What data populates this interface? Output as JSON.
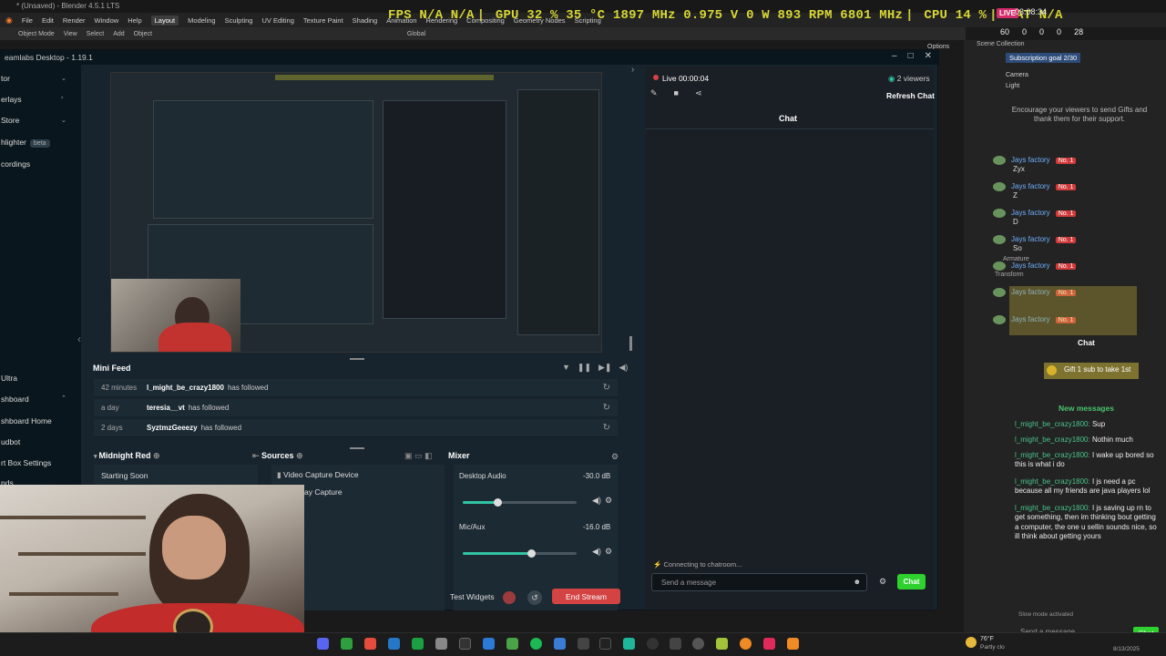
{
  "blender": {
    "title": "* (Unsaved) - Blender 4.5.1 LTS",
    "menu": [
      "File",
      "Edit",
      "Render",
      "Window",
      "Help"
    ],
    "workspaces": [
      "Layout",
      "Modeling",
      "Sculpting",
      "UV Editing",
      "Texture Paint",
      "Shading",
      "Animation",
      "Rendering",
      "Compositing",
      "Geometry Nodes",
      "Scripting"
    ],
    "active_workspace": "Layout",
    "toolbar": [
      "Object Mode",
      "View",
      "Select",
      "Add",
      "Object",
      "Global"
    ],
    "options": "Options",
    "scene_collection": "Scene Collection",
    "outliner": [
      "Camera",
      "Light"
    ],
    "properties": [
      "Armature",
      "Transform"
    ]
  },
  "perf_overlay": {
    "fps": "FPS N/A N/A",
    "gpu": "GPU 32 % 35 °C 1897 MHz 0.975 V 0 W 893 RPM 6801 MHz",
    "cpu": "CPU 14 %",
    "lat": "LAT N/A"
  },
  "stream_overlay": {
    "live": "LIVE",
    "clock": "03:08:34",
    "stats": [
      "60",
      "0",
      "0",
      "0",
      "28"
    ]
  },
  "streamlabs": {
    "title": "eamlabs Desktop - 1.19.1",
    "sidebar": [
      {
        "label": "tor",
        "chevron": true
      },
      {
        "label": "erlays",
        "chevron": false
      },
      {
        "label": "Store",
        "chevron": true
      },
      {
        "label": "hlighter",
        "beta": "beta"
      },
      {
        "label": "cordings"
      },
      {
        "label": "Ultra"
      },
      {
        "label": "shboard",
        "chevron": true
      },
      {
        "label": "shboard Home"
      },
      {
        "label": "udbot"
      },
      {
        "label": "rt Box Settings"
      },
      {
        "label": "nds"
      }
    ],
    "mini_feed": {
      "title": "Mini Feed",
      "rows": [
        {
          "time": "42 minutes",
          "name": "l_might_be_crazy1800",
          "action": "has followed"
        },
        {
          "time": "a day",
          "name": "teresia__vt",
          "action": "has followed"
        },
        {
          "time": "2 days",
          "name": "SyztmzGeeezy",
          "action": "has followed"
        }
      ]
    },
    "scenes": {
      "title": "Midnight Red",
      "items": [
        "Starting Soon"
      ]
    },
    "sources": {
      "title": "Sources",
      "items": [
        "Video Capture Device",
        "ay Capture"
      ]
    },
    "mixer": {
      "title": "Mixer",
      "channels": [
        {
          "name": "Desktop Audio",
          "db": "-30.0 dB",
          "level": 0.3
        },
        {
          "name": "Mic/Aux",
          "db": "-16.0 dB",
          "level": 0.6
        }
      ]
    },
    "footer": {
      "test_widgets": "Test Widgets",
      "end_stream": "End Stream"
    },
    "live": {
      "status": "Live 00:00:04",
      "viewers": "2 viewers",
      "refresh": "Refresh Chat",
      "chat_title": "Chat",
      "connecting": "Connecting to chatroom...",
      "input_placeholder": "Send a message",
      "chat_button": "Chat"
    }
  },
  "overlay_chat": {
    "subscription_goal": "Subscription goal 2/30",
    "gift_prompt": "Encourage your viewers to send Gifts and thank them for their support.",
    "supporter_rows": [
      {
        "user": "Jays factory",
        "badge": "No. 1",
        "text": "Zyx"
      },
      {
        "user": "Jays factory",
        "badge": "No. 1",
        "text": "Z"
      },
      {
        "user": "Jays factory",
        "badge": "No. 1",
        "text": "D"
      },
      {
        "user": "Jays factory",
        "badge": "No. 1",
        "text": "So"
      },
      {
        "user": "Jays factory",
        "badge": "No. 1",
        "text": ""
      },
      {
        "user": "Jays factory",
        "badge": "No. 1",
        "text": ""
      },
      {
        "user": "Jays factory",
        "badge": "No. 1",
        "text": ""
      }
    ],
    "chat_header": "Chat",
    "gift_line": "Gift 1 sub to take 1st",
    "new_messages": "New messages",
    "messages": [
      {
        "user": "l_might_be_crazy1800:",
        "text": "Sup"
      },
      {
        "user": "l_might_be_crazy1800:",
        "text": "Nothin much"
      },
      {
        "user": "l_might_be_crazy1800:",
        "text": "I wake up bored so this is what i do"
      },
      {
        "user": "l_might_be_crazy1800:",
        "text": "I js need a pc because all my friends are java players lol"
      },
      {
        "user": "l_might_be_crazy1800:",
        "text": "I js saving up rn to get something, then im thinking bout getting a computer, the one u sellin sounds nice, so ill think about getting yours"
      }
    ],
    "slow_mode": "Slow mode activated",
    "send_placeholder": "Send a message",
    "chat_button": "Chat"
  },
  "taskbar": {
    "weather_temp": "76°F",
    "weather_desc": "Partly clo",
    "date": "8/13/2025"
  },
  "colors": {
    "perf_yellow": "#d8d835",
    "chat_green": "#2ed12e",
    "end_stream_red": "#d34343",
    "live_pink": "#d42c6a",
    "username_green": "#49c38a"
  }
}
